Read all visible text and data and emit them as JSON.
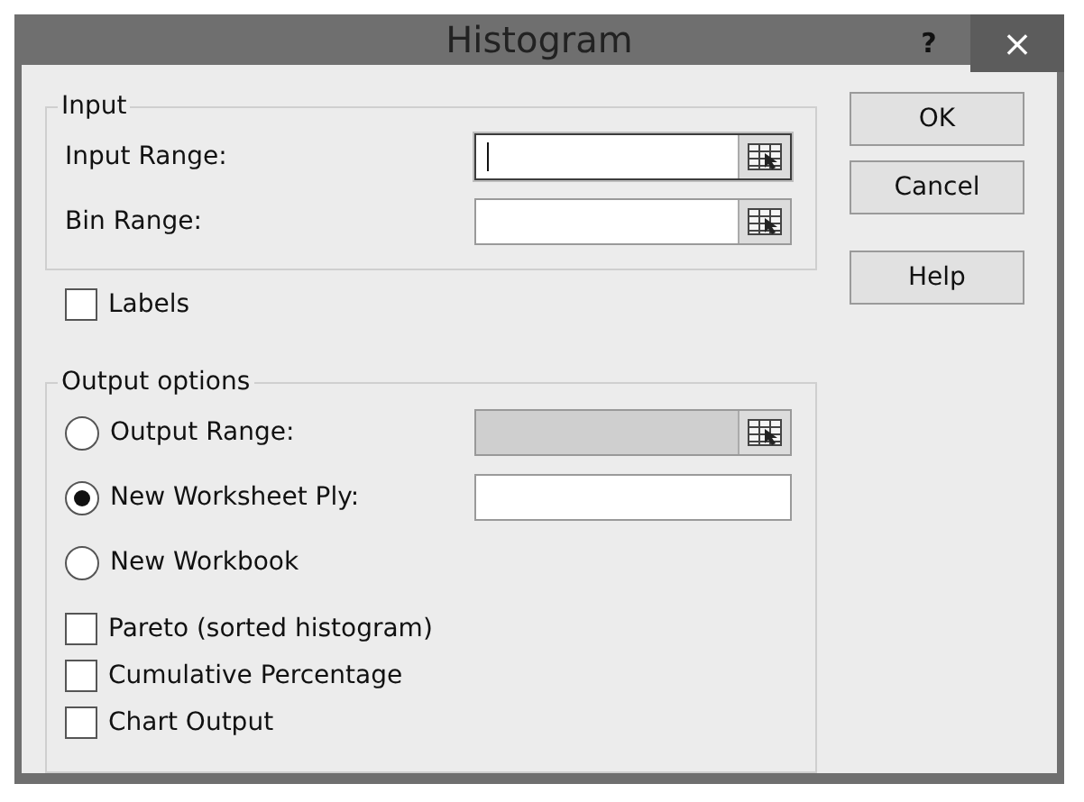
{
  "window": {
    "title": "Histogram",
    "help": "?",
    "close": "×"
  },
  "input_group": {
    "title": "Input",
    "fields": [
      {
        "label": "Input Range:",
        "focused": true,
        "disabled": false,
        "picker": true
      },
      {
        "label": "Bin Range:",
        "focused": false,
        "disabled": false,
        "picker": true
      }
    ]
  },
  "labels_checkbox": {
    "label": "Labels",
    "checked": false
  },
  "output_group": {
    "title": "Output options",
    "options": [
      {
        "label": "Output Range:",
        "selected": false,
        "field": {
          "focused": false,
          "disabled": true,
          "picker": true
        }
      },
      {
        "label": "New Worksheet Ply:",
        "selected": true,
        "field": {
          "focused": false,
          "disabled": false,
          "picker": false
        }
      },
      {
        "label": "New Workbook",
        "selected": false
      }
    ],
    "checkboxes": [
      {
        "label": "Pareto (sorted histogram)",
        "checked": false
      },
      {
        "label": "Cumulative Percentage",
        "checked": false
      },
      {
        "label": "Chart Output",
        "checked": false
      }
    ]
  },
  "buttons": [
    "OK",
    "Cancel",
    "Help"
  ]
}
